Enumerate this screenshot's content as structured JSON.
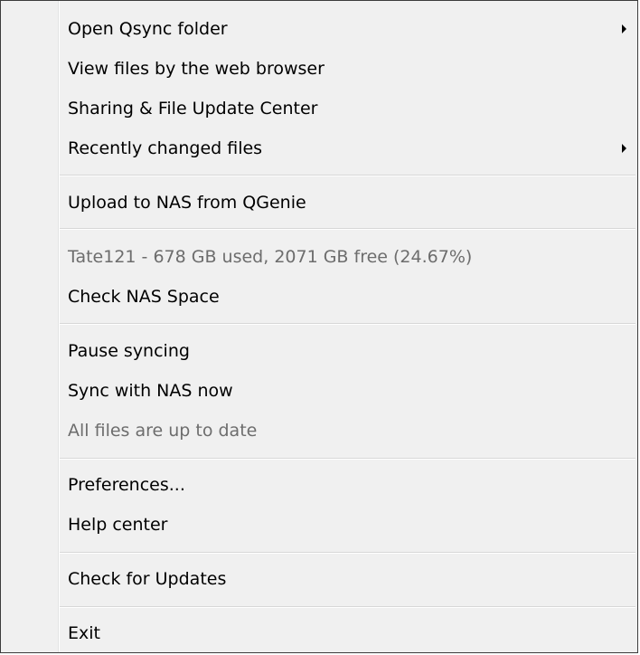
{
  "menu": {
    "items": [
      {
        "label": "Open Qsync folder",
        "submenu": true,
        "disabled": false
      },
      {
        "label": "View files by the web browser",
        "submenu": false,
        "disabled": false
      },
      {
        "label": "Sharing & File Update Center",
        "submenu": false,
        "disabled": false
      },
      {
        "label": "Recently changed files",
        "submenu": true,
        "disabled": false
      },
      {
        "label": "Upload to NAS from QGenie",
        "submenu": false,
        "disabled": false
      },
      {
        "label": "Tate121 -  678  GB used, 2071  GB free (24.67%)",
        "submenu": false,
        "disabled": true
      },
      {
        "label": "Check NAS Space",
        "submenu": false,
        "disabled": false
      },
      {
        "label": "Pause syncing",
        "submenu": false,
        "disabled": false
      },
      {
        "label": "Sync with NAS now",
        "submenu": false,
        "disabled": false
      },
      {
        "label": "All files are up to date",
        "submenu": false,
        "disabled": true
      },
      {
        "label": "Preferences...",
        "submenu": false,
        "disabled": false
      },
      {
        "label": "Help center",
        "submenu": false,
        "disabled": false
      },
      {
        "label": "Check for Updates",
        "submenu": false,
        "disabled": false
      },
      {
        "label": "Exit",
        "submenu": false,
        "disabled": false
      }
    ],
    "colors": {
      "background": "#f0f0f0",
      "text": "#000000",
      "disabled_text": "#6d6d6d",
      "border": "#3c3c3c",
      "separator": "#d7d7d7"
    }
  }
}
